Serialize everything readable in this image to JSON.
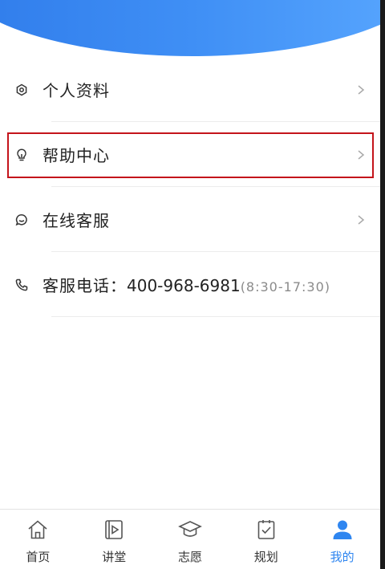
{
  "menu": {
    "items": [
      {
        "label": "个人资料",
        "icon": "gear-icon"
      },
      {
        "label": "帮助中心",
        "icon": "lightbulb-icon"
      },
      {
        "label": "在线客服",
        "icon": "chat-bubble-icon"
      }
    ],
    "phone": {
      "label_prefix": "客服电话：",
      "number": "400-968-6981",
      "hours": "(8:30-17:30)",
      "icon": "phone-icon"
    }
  },
  "tabbar": {
    "tabs": [
      {
        "label": "首页",
        "icon": "home-icon"
      },
      {
        "label": "讲堂",
        "icon": "video-play-icon"
      },
      {
        "label": "志愿",
        "icon": "graduation-cap-icon"
      },
      {
        "label": "规划",
        "icon": "clipboard-check-icon"
      },
      {
        "label": "我的",
        "icon": "user-icon"
      }
    ],
    "active_index": 4
  },
  "colors": {
    "accent": "#2f86f0",
    "header_gradient_start": "#2f7bea",
    "header_gradient_end": "#5aa8ff",
    "highlight_border": "#c4141b"
  }
}
